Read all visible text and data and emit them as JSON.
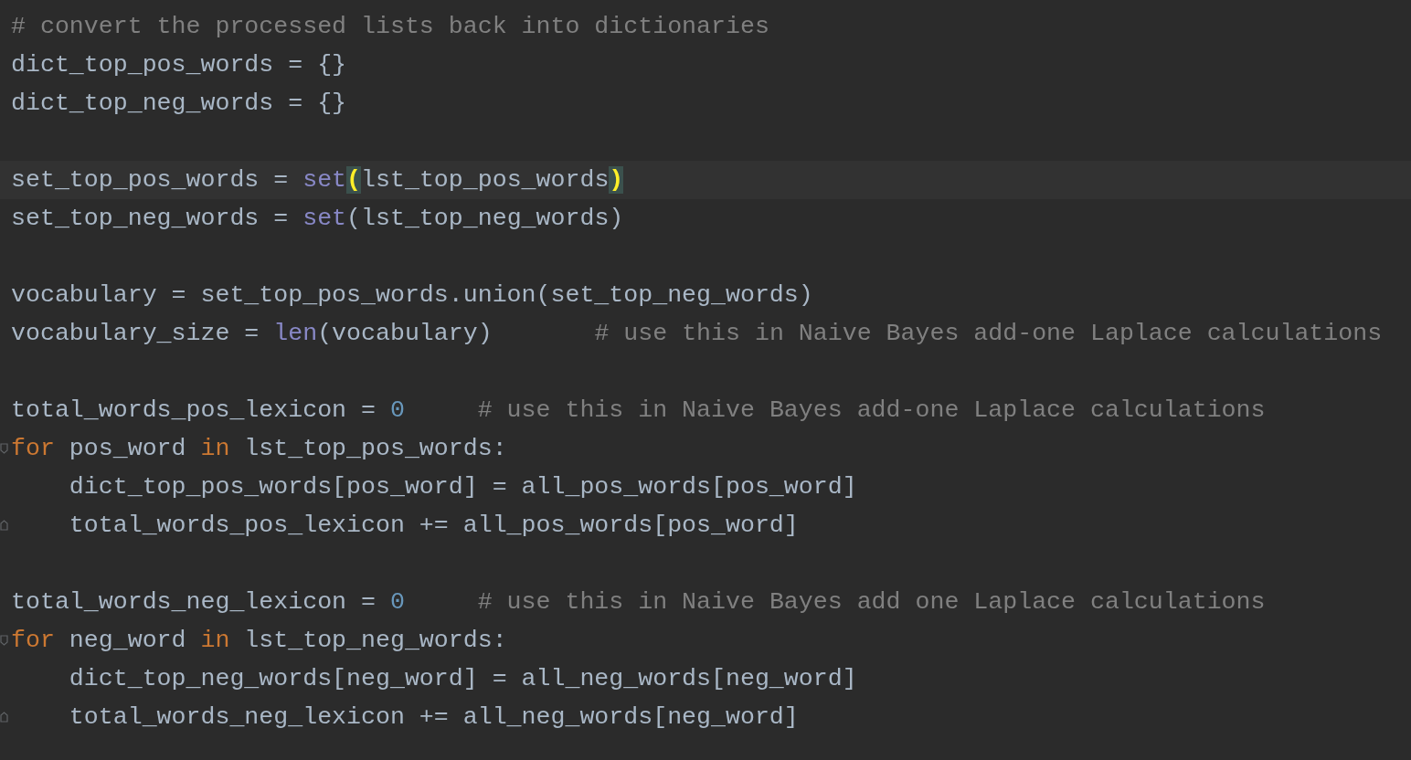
{
  "editor": {
    "blocks": [
      {
        "lines": [
          {
            "tokens": [
              {
                "kind": "comment",
                "text": "# convert the processed lists back into dictionaries"
              }
            ]
          },
          {
            "tokens": [
              {
                "kind": "plain",
                "text": "dict_top_pos_words = {}"
              }
            ]
          },
          {
            "tokens": [
              {
                "kind": "plain",
                "text": "dict_top_neg_words = {}"
              }
            ]
          }
        ]
      },
      {
        "lines": [
          {
            "current": true,
            "tokens": [
              {
                "kind": "plain",
                "text": "set_top_pos_words = "
              },
              {
                "kind": "builtin",
                "text": "set"
              },
              {
                "kind": "match",
                "text": "("
              },
              {
                "kind": "plain",
                "text": "lst_top_pos_words"
              },
              {
                "kind": "match",
                "text": ")"
              }
            ]
          },
          {
            "tokens": [
              {
                "kind": "plain",
                "text": "set_top_neg_words = "
              },
              {
                "kind": "builtin",
                "text": "set"
              },
              {
                "kind": "plain",
                "text": "(lst_top_neg_words)"
              }
            ]
          }
        ]
      },
      {
        "lines": [
          {
            "tokens": [
              {
                "kind": "plain",
                "text": "vocabulary = set_top_pos_words.union(set_top_neg_words)"
              }
            ]
          },
          {
            "tokens": [
              {
                "kind": "plain",
                "text": "vocabulary_size = "
              },
              {
                "kind": "builtin",
                "text": "len"
              },
              {
                "kind": "plain",
                "text": "(vocabulary)       "
              },
              {
                "kind": "comment",
                "text": "# use this in Naive Bayes add-one Laplace calculations"
              }
            ]
          }
        ]
      },
      {
        "lines": [
          {
            "tokens": [
              {
                "kind": "plain",
                "text": "total_words_pos_lexicon = "
              },
              {
                "kind": "number",
                "text": "0"
              },
              {
                "kind": "comment",
                "text": "     # use this in Naive Bayes add-one Laplace calculations"
              }
            ]
          },
          {
            "fold_start": true,
            "tokens": [
              {
                "kind": "keyword",
                "text": "for"
              },
              {
                "kind": "plain",
                "text": " pos_word "
              },
              {
                "kind": "keyword",
                "text": "in"
              },
              {
                "kind": "plain",
                "text": " lst_top_pos_words:"
              }
            ]
          },
          {
            "tokens": [
              {
                "kind": "plain",
                "text": "    dict_top_pos_words[pos_word] = all_pos_words[pos_word]"
              }
            ]
          },
          {
            "fold_end": true,
            "tokens": [
              {
                "kind": "plain",
                "text": "    total_words_pos_lexicon += all_pos_words[pos_word]"
              }
            ]
          }
        ]
      },
      {
        "lines": [
          {
            "tokens": [
              {
                "kind": "plain",
                "text": "total_words_neg_lexicon = "
              },
              {
                "kind": "number",
                "text": "0"
              },
              {
                "kind": "comment",
                "text": "     # use this in Naive Bayes add one Laplace calculations"
              }
            ]
          },
          {
            "fold_start": true,
            "tokens": [
              {
                "kind": "keyword",
                "text": "for"
              },
              {
                "kind": "plain",
                "text": " neg_word "
              },
              {
                "kind": "keyword",
                "text": "in"
              },
              {
                "kind": "plain",
                "text": " lst_top_neg_words:"
              }
            ]
          },
          {
            "tokens": [
              {
                "kind": "plain",
                "text": "    dict_top_neg_words[neg_word] = all_neg_words[neg_word]"
              }
            ]
          },
          {
            "fold_end": true,
            "tokens": [
              {
                "kind": "plain",
                "text": "    total_words_neg_lexicon += all_neg_words[neg_word]"
              }
            ]
          }
        ]
      }
    ]
  }
}
